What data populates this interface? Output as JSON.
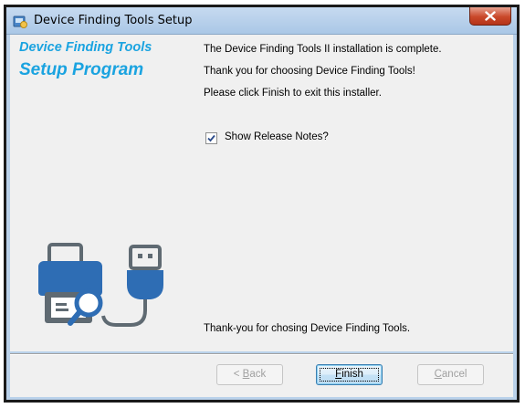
{
  "window": {
    "title": "Device Finding Tools Setup",
    "close_label": "X",
    "app_icon": "installer-icon"
  },
  "sidebar": {
    "brand_line1": "Device Finding Tools",
    "brand_line2": "Setup Program",
    "brand_color": "#1aa3e0",
    "illustration": "printer-usb-illustration"
  },
  "main": {
    "line1": "The Device Finding Tools II installation is complete.",
    "line2": "Thank you for choosing Device Finding Tools!",
    "line3": "Please click Finish to exit this installer.",
    "checkbox": {
      "label": "Show Release Notes?",
      "checked": true
    },
    "footer_text": "Thank-you for chosing Device Finding Tools."
  },
  "buttons": {
    "back": {
      "mnemonic": "B",
      "rest": "ack",
      "prefix": "< ",
      "enabled": false
    },
    "finish": {
      "mnemonic": "F",
      "rest": "inish",
      "enabled": true,
      "default": true
    },
    "cancel": {
      "mnemonic": "C",
      "rest": "ancel",
      "enabled": false
    }
  },
  "colors": {
    "icon_blue": "#2e6db4",
    "icon_gray": "#5f6a72"
  }
}
